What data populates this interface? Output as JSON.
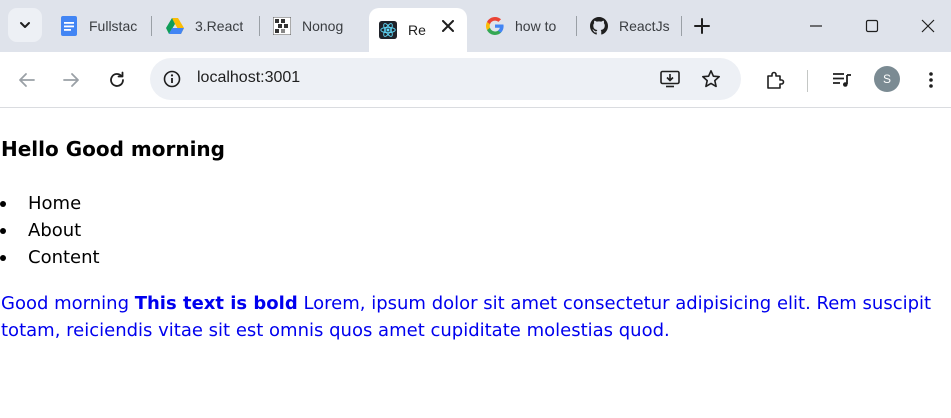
{
  "browser": {
    "tabs": [
      {
        "title": "Fullstac",
        "icon": "google-docs-icon",
        "active": false
      },
      {
        "title": "3.React",
        "icon": "google-drive-icon",
        "active": false
      },
      {
        "title": "Nonog",
        "icon": "nonogram-icon",
        "active": false
      },
      {
        "title": "Re",
        "icon": "react-icon",
        "active": true
      },
      {
        "title": "how to",
        "icon": "google-icon",
        "active": false
      },
      {
        "title": "ReactJs",
        "icon": "github-icon",
        "active": false
      }
    ],
    "address": "localhost:3001",
    "profile_initial": "S",
    "colors": {
      "tabstrip": "#dfe3eb",
      "omnibox": "#edf0f5",
      "avatar": "#7b8b93",
      "link": "#0000ee"
    }
  },
  "page": {
    "heading": "Hello Good morning",
    "nav_items": [
      "Home",
      "About",
      "Content"
    ],
    "paragraph": {
      "lead": "Good morning ",
      "bold": "This text is bold",
      "rest": " Lorem, ipsum dolor sit amet consectetur adipisicing elit. Rem suscipit totam, reiciendis vitae sit est omnis quos amet cupiditate molestias quod."
    }
  }
}
